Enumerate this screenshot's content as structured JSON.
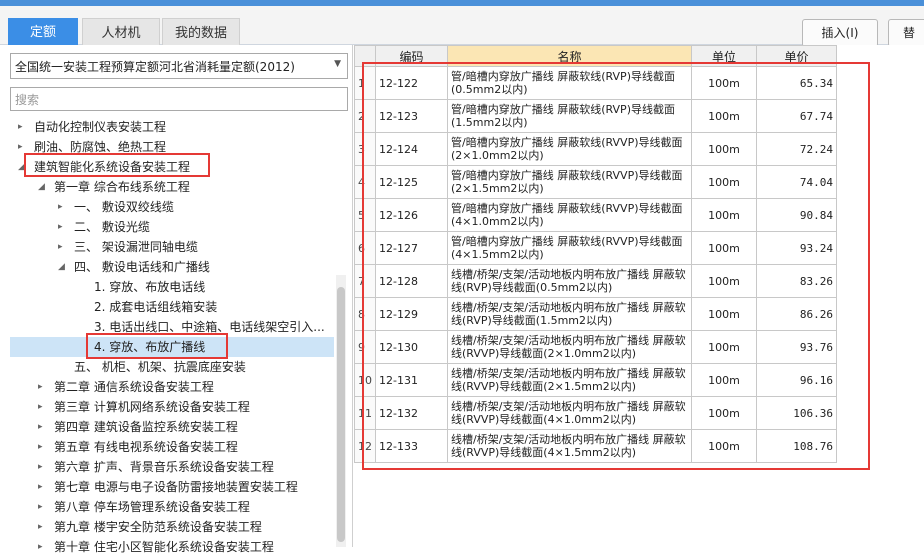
{
  "tabs": [
    {
      "label": "定额",
      "active": true
    },
    {
      "label": "人材机",
      "active": false
    },
    {
      "label": "我的数据",
      "active": false
    }
  ],
  "toolbar": {
    "insert_label": "插入(I)",
    "next_label": "替"
  },
  "left": {
    "quota_select": "全国统一安装工程预算定额河北省消耗量定额(2012)",
    "search_placeholder": "搜索",
    "tree": [
      {
        "label": "自动化控制仪表安装工程",
        "expanded": false
      },
      {
        "label": "刷油、防腐蚀、绝热工程",
        "expanded": false
      },
      {
        "label": "建筑智能化系统设备安装工程",
        "expanded": true
      },
      {
        "label": "第一章 综合布线系统工程",
        "expanded": true
      },
      {
        "label": "一、 敷设双绞线缆",
        "expanded": false
      },
      {
        "label": "二、 敷设光缆",
        "expanded": false
      },
      {
        "label": "三、 架设漏泄同轴电缆",
        "expanded": false
      },
      {
        "label": "四、 敷设电话线和广播线",
        "expanded": true
      },
      {
        "label": "1. 穿放、布放电话线"
      },
      {
        "label": "2. 成套电话组线箱安装"
      },
      {
        "label": "3. 电话出线口、中途箱、电话线架空引入..."
      },
      {
        "label": "4. 穿放、布放广播线",
        "selected": true
      },
      {
        "label": "五、 机柜、机架、抗震底座安装"
      },
      {
        "label": "第二章 通信系统设备安装工程",
        "expanded": false
      },
      {
        "label": "第三章 计算机网络系统设备安装工程",
        "expanded": false
      },
      {
        "label": "第四章 建筑设备监控系统安装工程",
        "expanded": false
      },
      {
        "label": "第五章 有线电视系统设备安装工程",
        "expanded": false
      },
      {
        "label": "第六章 扩声、背景音乐系统设备安装工程",
        "expanded": false
      },
      {
        "label": "第七章 电源与电子设备防雷接地装置安装工程",
        "expanded": false
      },
      {
        "label": "第八章 停车场管理系统设备安装工程",
        "expanded": false
      },
      {
        "label": "第九章 楼宇安全防范系统设备安装工程",
        "expanded": false
      },
      {
        "label": "第十章 住宅小区智能化系统设备安装工程",
        "expanded": false
      }
    ]
  },
  "grid": {
    "headers": [
      "",
      "编码",
      "名称",
      "单位",
      "单价"
    ],
    "rows": [
      {
        "n": "1",
        "code": "12-122",
        "name": "管/暗槽内穿放广播线 屏蔽软线(RVP)导线截面(0.5mm2以内)",
        "unit": "100m",
        "price": "65.34"
      },
      {
        "n": "2",
        "code": "12-123",
        "name": "管/暗槽内穿放广播线 屏蔽软线(RVP)导线截面(1.5mm2以内)",
        "unit": "100m",
        "price": "67.74"
      },
      {
        "n": "3",
        "code": "12-124",
        "name": "管/暗槽内穿放广播线 屏蔽软线(RVVP)导线截面(2×1.0mm2以内)",
        "unit": "100m",
        "price": "72.24"
      },
      {
        "n": "4",
        "code": "12-125",
        "name": "管/暗槽内穿放广播线 屏蔽软线(RVVP)导线截面(2×1.5mm2以内)",
        "unit": "100m",
        "price": "74.04"
      },
      {
        "n": "5",
        "code": "12-126",
        "name": "管/暗槽内穿放广播线 屏蔽软线(RVVP)导线截面(4×1.0mm2以内)",
        "unit": "100m",
        "price": "90.84"
      },
      {
        "n": "6",
        "code": "12-127",
        "name": "管/暗槽内穿放广播线 屏蔽软线(RVVP)导线截面(4×1.5mm2以内)",
        "unit": "100m",
        "price": "93.24"
      },
      {
        "n": "7",
        "code": "12-128",
        "name": "线槽/桥架/支架/活动地板内明布放广播线 屏蔽软线(RVP)导线截面(0.5mm2以内)",
        "unit": "100m",
        "price": "83.26"
      },
      {
        "n": "8",
        "code": "12-129",
        "name": "线槽/桥架/支架/活动地板内明布放广播线 屏蔽软线(RVP)导线截面(1.5mm2以内)",
        "unit": "100m",
        "price": "86.26"
      },
      {
        "n": "9",
        "code": "12-130",
        "name": "线槽/桥架/支架/活动地板内明布放广播线 屏蔽软线(RVVP)导线截面(2×1.0mm2以内)",
        "unit": "100m",
        "price": "93.76"
      },
      {
        "n": "10",
        "code": "12-131",
        "name": "线槽/桥架/支架/活动地板内明布放广播线 屏蔽软线(RVVP)导线截面(2×1.5mm2以内)",
        "unit": "100m",
        "price": "96.16"
      },
      {
        "n": "11",
        "code": "12-132",
        "name": "线槽/桥架/支架/活动地板内明布放广播线 屏蔽软线(RVVP)导线截面(4×1.0mm2以内)",
        "unit": "100m",
        "price": "106.36"
      },
      {
        "n": "12",
        "code": "12-133",
        "name": "线槽/桥架/支架/活动地板内明布放广播线 屏蔽软线(RVVP)导线截面(4×1.5mm2以内)",
        "unit": "100m",
        "price": "108.76"
      }
    ]
  },
  "colors": {
    "accent": "#3b8ee6",
    "highlight_box": "#e53935",
    "name_header": "#fbe6b4",
    "selected_row": "#cde4f7"
  }
}
